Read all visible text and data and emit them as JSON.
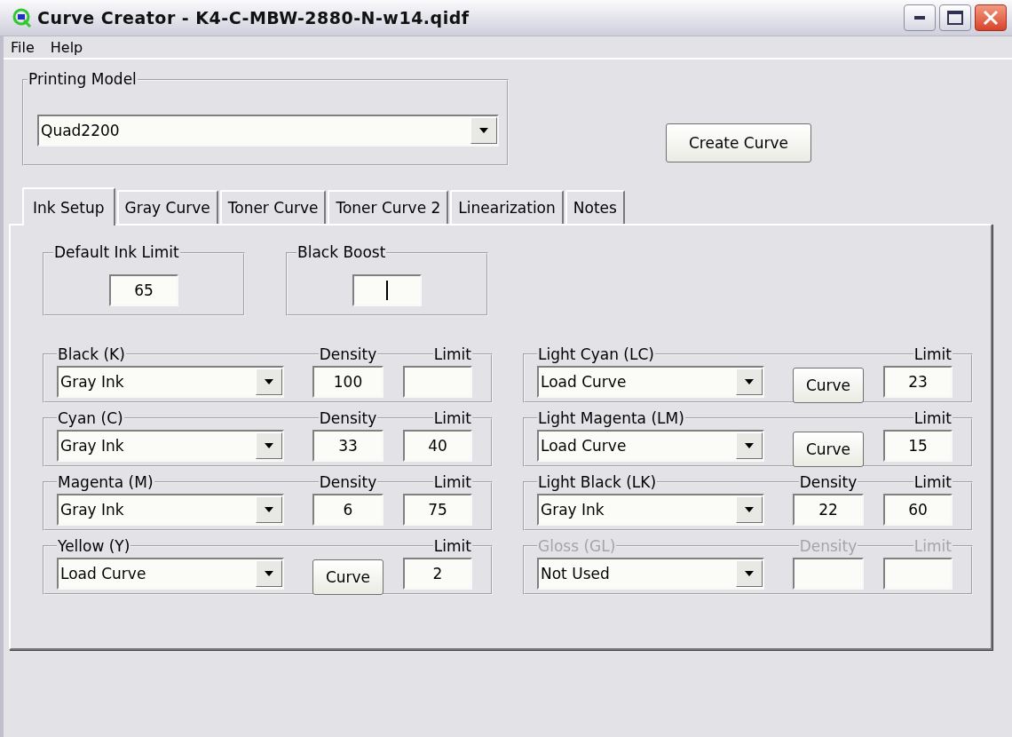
{
  "window": {
    "title": "Curve Creator - K4-C-MBW-2880-N-w14.qidf"
  },
  "menu": [
    "File",
    "Help"
  ],
  "printing_model": {
    "label": "Printing Model",
    "value": "Quad2200"
  },
  "create_button": "Create Curve",
  "tabs": [
    {
      "label": "Ink Setup",
      "selected": true
    },
    {
      "label": "Gray Curve",
      "selected": false
    },
    {
      "label": "Toner Curve",
      "selected": false
    },
    {
      "label": "Toner Curve 2",
      "selected": false
    },
    {
      "label": "Linearization",
      "selected": false
    },
    {
      "label": "Notes",
      "selected": false
    }
  ],
  "default_ink_limit": {
    "label": "Default Ink Limit",
    "value": "65"
  },
  "black_boost": {
    "label": "Black Boost",
    "focused": true
  },
  "channels_left": [
    {
      "name": "Black (K)",
      "kind": "density",
      "value": "Gray Ink",
      "density_label": "Density",
      "density": "100",
      "limit_label": "Limit",
      "disabled": false
    },
    {
      "name": "Cyan (C)",
      "kind": "density",
      "value": "Gray Ink",
      "density_label": "Density",
      "density": "33",
      "limit_label": "Limit",
      "limit": "40",
      "disabled": false
    },
    {
      "name": "Magenta (M)",
      "kind": "density",
      "value": "Gray Ink",
      "density_label": "Density",
      "density": "6",
      "limit_label": "Limit",
      "limit": "75",
      "disabled": false
    },
    {
      "name": "Yellow (Y)",
      "kind": "curve",
      "value": "Load Curve",
      "button": "Curve",
      "limit_label": "Limit",
      "limit": "2",
      "disabled": false
    }
  ],
  "channels_right": [
    {
      "name": "Light Cyan (LC)",
      "kind": "curve",
      "value": "Load Curve",
      "button": "Curve",
      "limit_label": "Limit",
      "limit": "23",
      "disabled": false
    },
    {
      "name": "Light Magenta (LM)",
      "kind": "curve",
      "value": "Load Curve",
      "button": "Curve",
      "limit_label": "Limit",
      "limit": "15",
      "disabled": false
    },
    {
      "name": "Light Black (LK)",
      "kind": "density",
      "value": "Gray Ink",
      "density_label": "Density",
      "density": "22",
      "limit_label": "Limit",
      "limit": "60",
      "disabled": false
    },
    {
      "name": "Gloss (GL)",
      "kind": "density",
      "value": "Not Used",
      "density_label": "Density",
      "limit_label": "Limit",
      "disabled": true
    }
  ]
}
